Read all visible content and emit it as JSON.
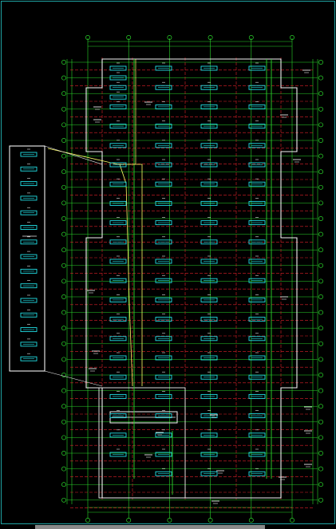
{
  "viewport": {
    "background": "#000000",
    "frame_color": "#1fa3a3"
  },
  "drawing": {
    "grid_axis_color": "#2bd62b",
    "dash_line_color": "#e0202a",
    "wall_color": "#f2f2f2",
    "fixture_color": "#22e0e6",
    "annotation_color": "#e8e8e8",
    "pipe_color": "#ffff66",
    "column_bays": 5,
    "fixture_columns": 4,
    "fixture_rows": 22,
    "detail_callout_fixtures": 15
  },
  "icons": {
    "axis_bubble": "axis-bubble-icon",
    "fixture": "light-fixture-icon"
  }
}
